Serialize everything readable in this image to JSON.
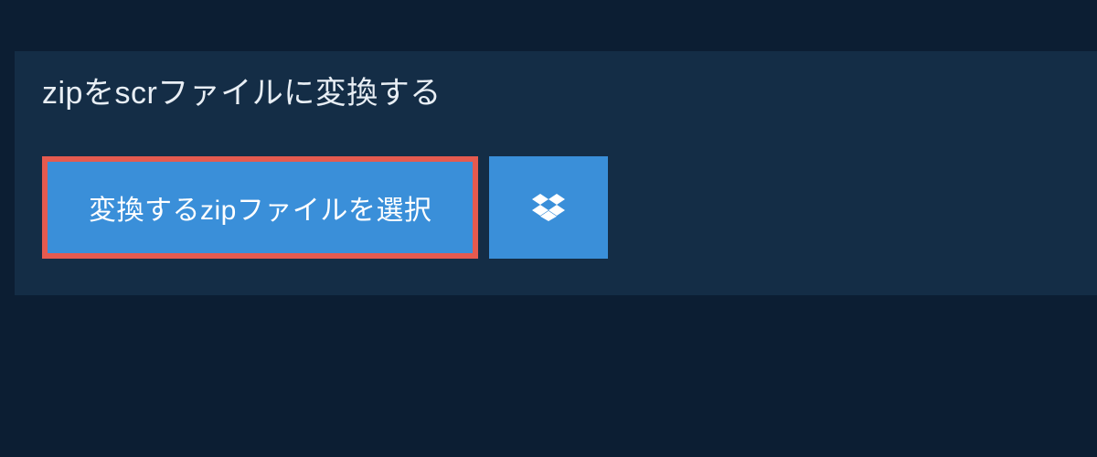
{
  "heading": "zipをscrファイルに変換する",
  "select_button_label": "変換するzipファイルを選択",
  "colors": {
    "background": "#0c1e33",
    "panel": "#142d46",
    "button": "#3a8fd9",
    "border_highlight": "#e55a4f",
    "text_light": "#e8eef4"
  }
}
